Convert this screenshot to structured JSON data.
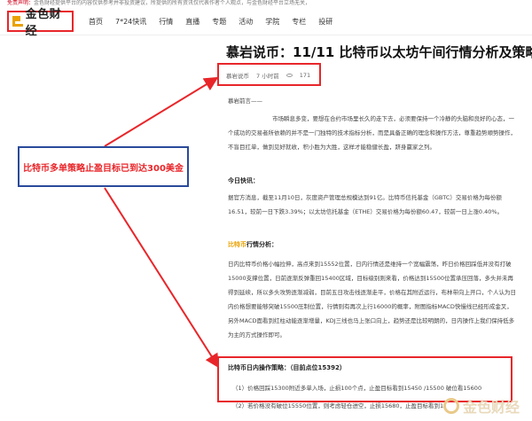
{
  "notice": {
    "label": "免责声明：",
    "text": "金色财经提供平台的内容仅供参考并非投资建议，所提供的所有资讯仅代表作者个人观点，与金色财经平台立场无关，"
  },
  "header": {
    "logo_text": "金色财经",
    "nav": [
      "首页",
      "7*24快讯",
      "行情",
      "直播",
      "专题",
      "活动",
      "学院",
      "专栏",
      "投研"
    ]
  },
  "article": {
    "title": "慕岩说币：11/11 比特币以太坊午间行情分析及策略",
    "author": "慕岩说币",
    "time": "7 小时前",
    "views": "171",
    "preface": "慕岩前言——",
    "intro": "市场瞬息多变，要想在合约市场里长久的走下去，必须要保持一个冷静的头脑和良好的心态，一个成功的交易者所依赖的并不是一门独特的技术指标分析，而是具备正确的理念和操作方法，尊重趋势顺势操作，不盲目扛单，做到见好就收，积小胜为大胜，这样才能稳健长盈，跻身赢家之列。",
    "section_today": "今日快讯：",
    "news": "据官方消息，截至11月10日，灰度资产管理总规模达到91亿。比特币信托基金（GBTC）交易价格为每份额16.51，较前一日下跌3.39%；以太坊信托基金（ETHE）交易价格为每份额60.47，较前一日上涨0.40%。",
    "section_analysis_prefix": "比特币",
    "section_analysis_suffix": "行情分析：",
    "analysis": "日内比特币价格小幅拉伸，高点来到15552位置，日内行情还是维持一个宽幅震荡，昨日价格回踩低并没有打破15000支撑位置，日前逐渐反弹重回15400区域，目标级别则来看，价格达到15500位置承压回落，多头并未再得到延续，所以多头攻势逐渐减弱，目前五日攻击线逐渐走平，价格在其附近运行，布林带向上开口，个人认为日内价格想要能够突破15500压制位置，行情则有再次上行16000的概率，附图指标MACD快慢线已经形成金叉，另外MACD面看到红柱动能逐渐增量，KDJ三线也马上张口向上，趋势还是比较明朗的，日内操作上我们保持低多为主的方式操作即可。",
    "op_title": "比特币日内操作策略：（目前点位15392）",
    "op1": "（1）价格回踩15300附近多单入场，止损100个点，止盈目标看到15450 /15500  破位看15600",
    "op2": "（2）若价格没有破位15550位置，则考虑轻仓进空，止损15680，止盈目标看到15400 /1"
  },
  "annotation": {
    "text": "比特币多单策略止盈目标已到达300美金"
  },
  "watermark": {
    "text": "金色财经"
  },
  "colors": {
    "annotation_red": "#e8262a",
    "annotation_blue": "#2a4a9a",
    "brand_gold": "#e9a100"
  }
}
